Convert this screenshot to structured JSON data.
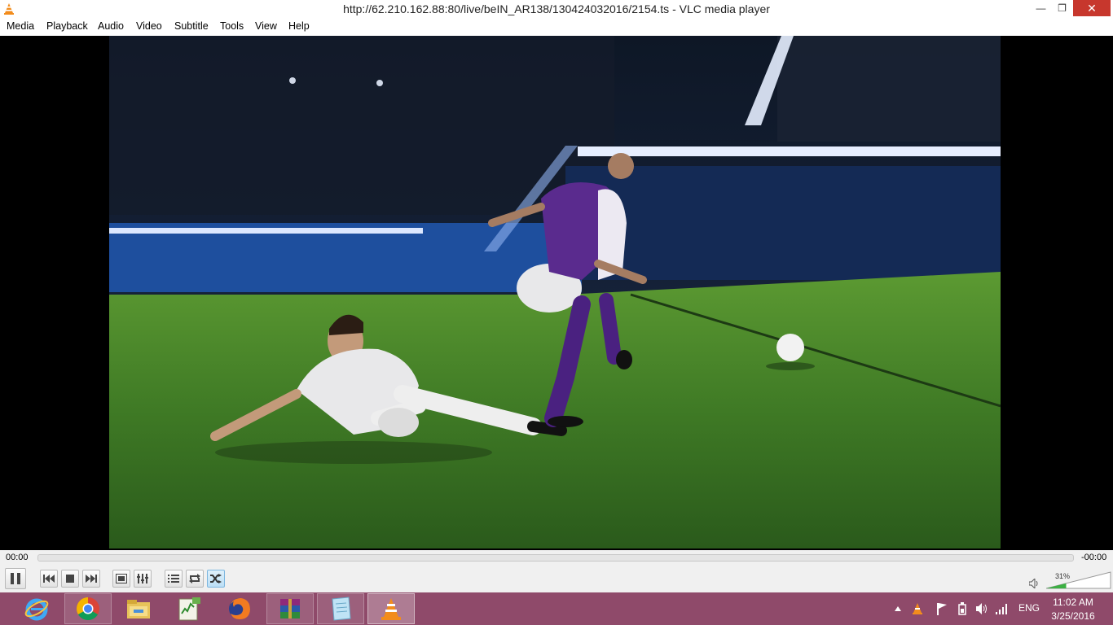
{
  "window": {
    "title": "http://62.210.162.88:80/live/beIN_AR138/130424032016/2154.ts - VLC media player",
    "minimize_glyph": "—",
    "maximize_glyph": "❐",
    "close_glyph": "✕"
  },
  "menu": [
    "Media",
    "Playback",
    "Audio",
    "Video",
    "Subtitle",
    "Tools",
    "View",
    "Help"
  ],
  "player": {
    "elapsed": "00:00",
    "remaining": "-00:00",
    "seek_progress": 0,
    "volume_label": "31%",
    "volume_level": 0.31
  },
  "controls": [
    {
      "name": "pause-icon",
      "state": "normal"
    },
    {
      "name": "previous-icon",
      "state": "normal"
    },
    {
      "name": "stop-icon",
      "state": "normal"
    },
    {
      "name": "next-icon",
      "state": "normal"
    },
    {
      "name": "fullscreen-icon",
      "state": "normal"
    },
    {
      "name": "extended-settings-icon",
      "state": "normal"
    },
    {
      "name": "playlist-icon",
      "state": "normal"
    },
    {
      "name": "loop-icon",
      "state": "normal"
    },
    {
      "name": "shuffle-icon",
      "state": "active"
    }
  ],
  "taskbar": {
    "apps": [
      {
        "name": "internet-explorer-icon",
        "state": "pinned"
      },
      {
        "name": "chrome-icon",
        "state": "open"
      },
      {
        "name": "file-explorer-icon",
        "state": "pinned"
      },
      {
        "name": "task-manager-icon",
        "state": "pinned"
      },
      {
        "name": "firefox-icon",
        "state": "pinned"
      },
      {
        "name": "winrar-icon",
        "state": "open"
      },
      {
        "name": "notepad-icon",
        "state": "open"
      },
      {
        "name": "vlc-icon",
        "state": "active"
      }
    ],
    "tray": {
      "language": "ENG",
      "time": "11:02 AM",
      "date": "3/25/2016"
    }
  },
  "colors": {
    "taskbar": "#8f4a6a",
    "close_button": "#c7372d",
    "vlc_orange": "#f28c1c",
    "volume_green": "#3cb043"
  }
}
